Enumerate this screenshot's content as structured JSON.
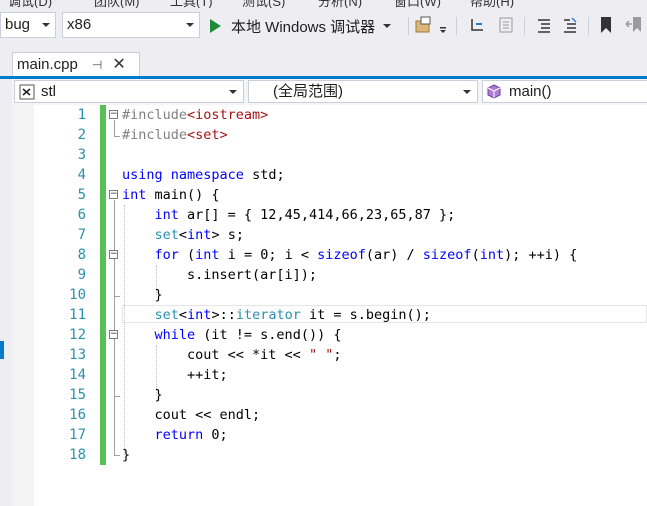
{
  "menu": {
    "partial_items": [
      "调试(D)",
      "团队(M)",
      "工具(T)",
      "测试(S)",
      "分析(N)",
      "窗口(W)",
      "帮助(H)"
    ]
  },
  "toolbar": {
    "config_combo": "bug",
    "platform_combo": "x86",
    "start_label": "本地 Windows 调试器",
    "icons": [
      "find-in-files-icon",
      "toolbar-options-icon",
      "step-into-icon",
      "breakpoints-icon",
      "comment-icon",
      "uncomment-icon",
      "bookmark-icon",
      "prev-bookmark-icon"
    ]
  },
  "tab": {
    "filename": "main.cpp",
    "pin_glyph": "⊣",
    "close_glyph": "✕"
  },
  "navbar": {
    "project": "stl",
    "scope": "(全局范围)",
    "member": "main()"
  },
  "editor": {
    "lines": [
      {
        "n": "1",
        "segments": [
          [
            "pp",
            "#include"
          ],
          [
            "inc",
            "<iostream>"
          ]
        ]
      },
      {
        "n": "2",
        "segments": [
          [
            "pp",
            "#include"
          ],
          [
            "inc",
            "<set>"
          ]
        ]
      },
      {
        "n": "3",
        "segments": []
      },
      {
        "n": "4",
        "segments": [
          [
            "kw",
            "using"
          ],
          [
            "",
            " "
          ],
          [
            "kw",
            "namespace"
          ],
          [
            "",
            " std;"
          ]
        ]
      },
      {
        "n": "5",
        "segments": [
          [
            "kw",
            "int"
          ],
          [
            "",
            " main() {"
          ]
        ]
      },
      {
        "n": "6",
        "segments": [
          [
            "",
            "    "
          ],
          [
            "kw",
            "int"
          ],
          [
            "",
            " ar[] = { 12,45,414,66,23,65,87 };"
          ]
        ]
      },
      {
        "n": "7",
        "segments": [
          [
            "",
            "    "
          ],
          [
            "typ",
            "set"
          ],
          [
            "",
            "<"
          ],
          [
            "kw",
            "int"
          ],
          [
            "",
            "> s;"
          ]
        ]
      },
      {
        "n": "8",
        "segments": [
          [
            "",
            "    "
          ],
          [
            "kw",
            "for"
          ],
          [
            "",
            " ("
          ],
          [
            "kw",
            "int"
          ],
          [
            "",
            " i = 0; i < "
          ],
          [
            "kw",
            "sizeof"
          ],
          [
            "",
            "(ar) / "
          ],
          [
            "kw",
            "sizeof"
          ],
          [
            "",
            "("
          ],
          [
            "kw",
            "int"
          ],
          [
            "",
            "); ++i) {"
          ]
        ]
      },
      {
        "n": "9",
        "segments": [
          [
            "",
            "        s.insert(ar[i]);"
          ]
        ]
      },
      {
        "n": "10",
        "segments": [
          [
            "",
            "    }"
          ]
        ]
      },
      {
        "n": "11",
        "segments": [
          [
            "",
            "    "
          ],
          [
            "typ",
            "set"
          ],
          [
            "",
            "<"
          ],
          [
            "kw",
            "int"
          ],
          [
            "",
            ">::"
          ],
          [
            "typ",
            "iterator"
          ],
          [
            "",
            " it = s.begin();"
          ]
        ]
      },
      {
        "n": "12",
        "segments": [
          [
            "",
            "    "
          ],
          [
            "kw",
            "while"
          ],
          [
            "",
            " (it != s.end()) {"
          ]
        ]
      },
      {
        "n": "13",
        "segments": [
          [
            "",
            "        cout << *it << "
          ],
          [
            "str",
            "\" \""
          ],
          [
            "",
            ";"
          ]
        ]
      },
      {
        "n": "14",
        "segments": [
          [
            "",
            "        ++it;"
          ]
        ]
      },
      {
        "n": "15",
        "segments": [
          [
            "",
            "    }"
          ]
        ]
      },
      {
        "n": "16",
        "segments": [
          [
            "",
            "    cout << endl;"
          ]
        ]
      },
      {
        "n": "17",
        "segments": [
          [
            "",
            "    "
          ],
          [
            "kw",
            "return"
          ],
          [
            "",
            " 0;"
          ]
        ]
      },
      {
        "n": "18",
        "segments": [
          [
            "",
            "}"
          ]
        ]
      }
    ],
    "fold_lines": [
      "1",
      "5",
      "8",
      "12"
    ]
  },
  "colors": {
    "accent": "#007acc",
    "keyword": "#0000ff",
    "string": "#a31515",
    "type": "#2b91af",
    "preprocessor": "#808080",
    "change_bar": "#57c057"
  }
}
